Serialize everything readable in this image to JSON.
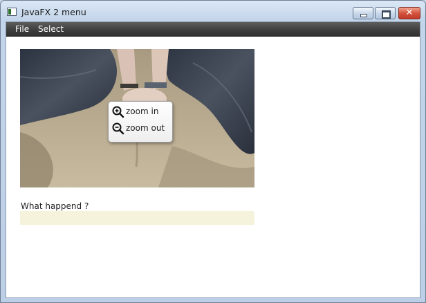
{
  "window": {
    "title": "JavaFX 2 menu",
    "title_icon": "java-app-icon",
    "buttons": {
      "minimize_icon": "minimize-icon",
      "maximize_icon": "maximize-icon",
      "close_icon": "close-icon",
      "close_glyph": "✕"
    }
  },
  "menubar": {
    "items": [
      {
        "label": "File"
      },
      {
        "label": "Select"
      }
    ]
  },
  "photo": {
    "subject": "photo-image"
  },
  "context_menu": {
    "items": [
      {
        "label": "zoom in",
        "icon": "zoom-in-icon"
      },
      {
        "label": "zoom out",
        "icon": "zoom-out-icon"
      }
    ]
  },
  "form": {
    "question_label": "What happend ?",
    "answer_value": "",
    "answer_placeholder": ""
  },
  "colors": {
    "menubar": "#3d3d3d",
    "input_background": "#f6f3dc",
    "close_button": "#c0392b"
  }
}
